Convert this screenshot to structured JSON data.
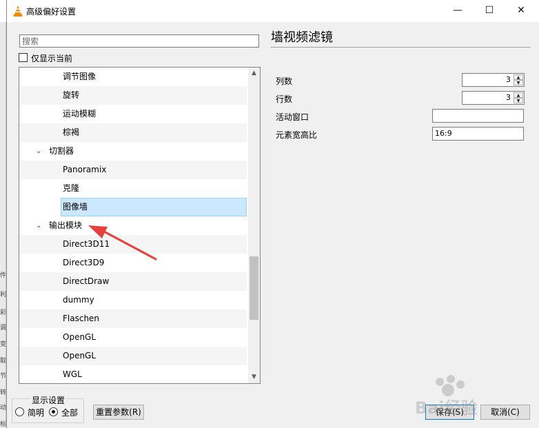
{
  "window": {
    "title": "高级偏好设置",
    "controls": {
      "minimize": "—",
      "maximize": "☐",
      "close": "✕"
    }
  },
  "search": {
    "placeholder": "搜索",
    "value": ""
  },
  "only_current": {
    "label": "仅显示当前",
    "checked": false
  },
  "tree": {
    "items": [
      {
        "label": "调节图像",
        "level": 2
      },
      {
        "label": "旋转",
        "level": 2
      },
      {
        "label": "运动模糊",
        "level": 2
      },
      {
        "label": "棕褐",
        "level": 2
      },
      {
        "label": "切割器",
        "level": 1,
        "expanded": true
      },
      {
        "label": "Panoramix",
        "level": 2
      },
      {
        "label": "克隆",
        "level": 2
      },
      {
        "label": "图像墙",
        "level": 2,
        "selected": true
      },
      {
        "label": "输出模块",
        "level": 1,
        "expanded": true
      },
      {
        "label": "Direct3D11",
        "level": 2
      },
      {
        "label": "Direct3D9",
        "level": 2
      },
      {
        "label": "DirectDraw",
        "level": 2
      },
      {
        "label": "dummy",
        "level": 2
      },
      {
        "label": "Flaschen",
        "level": 2
      },
      {
        "label": "OpenGL",
        "level": 2
      },
      {
        "label": "OpenGL",
        "level": 2
      },
      {
        "label": "WGL",
        "level": 2
      }
    ]
  },
  "panel": {
    "title": "墙视频滤镜",
    "fields": {
      "columns": {
        "label": "列数",
        "value": "3"
      },
      "rows": {
        "label": "行数",
        "value": "3"
      },
      "active_windows": {
        "label": "活动窗口",
        "value": ""
      },
      "aspect_ratio": {
        "label": "元素宽高比",
        "value": "16:9"
      }
    }
  },
  "display_settings": {
    "label": "显示设置",
    "simple": "简明",
    "all": "全部",
    "selected": "all"
  },
  "buttons": {
    "reset": "重置参数(R)",
    "save": "保存(S)",
    "cancel": "取消(C)"
  },
  "background_window_chars": [
    "件",
    "利",
    "彩",
    "调",
    "变",
    "取",
    "节",
    "转",
    "动",
    "标"
  ],
  "watermark_text": "Bai经验",
  "colors": {
    "selection_fill": "#cce8ff",
    "annotation_arrow": "#e8403a",
    "vlc_orange": "#f08a00"
  },
  "icons": {
    "app": "vlc-cone-icon",
    "expand": "chevron-down-icon",
    "scroll_up": "chevron-up-icon",
    "scroll_down": "chevron-down-icon"
  }
}
